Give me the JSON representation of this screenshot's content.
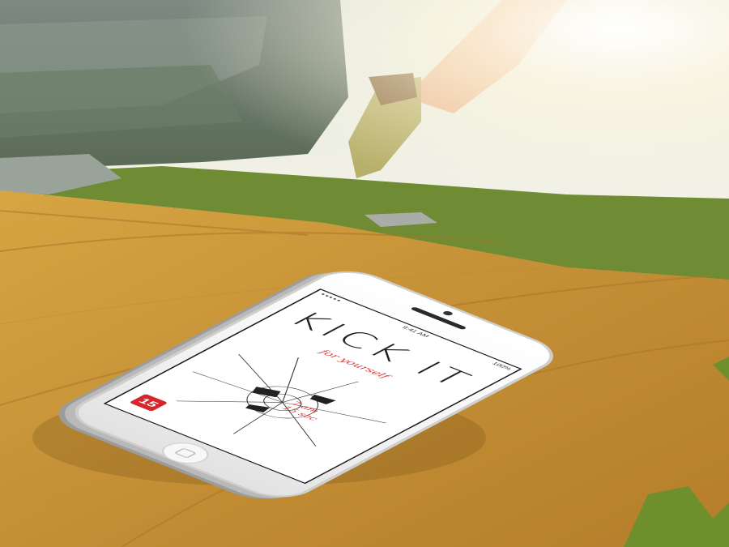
{
  "scene": {
    "description_elements": [
      "mountain-landscape",
      "running-legs",
      "wooden-table",
      "smartphone",
      "leaves"
    ]
  },
  "phone": {
    "status_time": "9:41 AM",
    "status_battery": "100%",
    "signal_icon": "signal-icon",
    "app_title": "KICK IT",
    "tagline": "for yourself",
    "time_line1": "7 am",
    "time_line2": "15 sec",
    "brand": "15"
  },
  "colors": {
    "accent_red": "#d33333",
    "wood": "#c9973c",
    "grass": "#6c8a2e"
  }
}
